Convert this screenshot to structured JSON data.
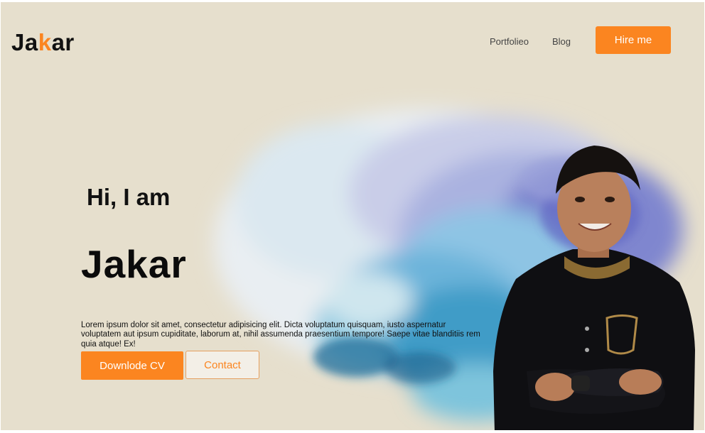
{
  "header": {
    "logo_part1": "Ja",
    "logo_accent": "k",
    "logo_part2": "ar",
    "nav": [
      {
        "label": "Portfolieo"
      },
      {
        "label": "Blog"
      }
    ],
    "hire_label": "Hire me"
  },
  "hero": {
    "greeting": "Hi, I am",
    "name": "Jakar",
    "bio": "Lorem ipsum dolor sit amet, consectetur adipisicing elit. Dicta voluptatum quisquam, iusto aspernatur voluptatem aut ipsum cupiditate, laborum at, nihil assumenda praesentium tempore! Saepe vitae blanditiis rem quia atque! Ex!",
    "download_label": "Downlode CV",
    "contact_label": "Contact"
  },
  "colors": {
    "accent": "#fb8520",
    "background": "#e6dfcd",
    "text": "#111111"
  },
  "images": {
    "splash": "watercolor-splash-image",
    "portrait": "profile-photo-image"
  }
}
